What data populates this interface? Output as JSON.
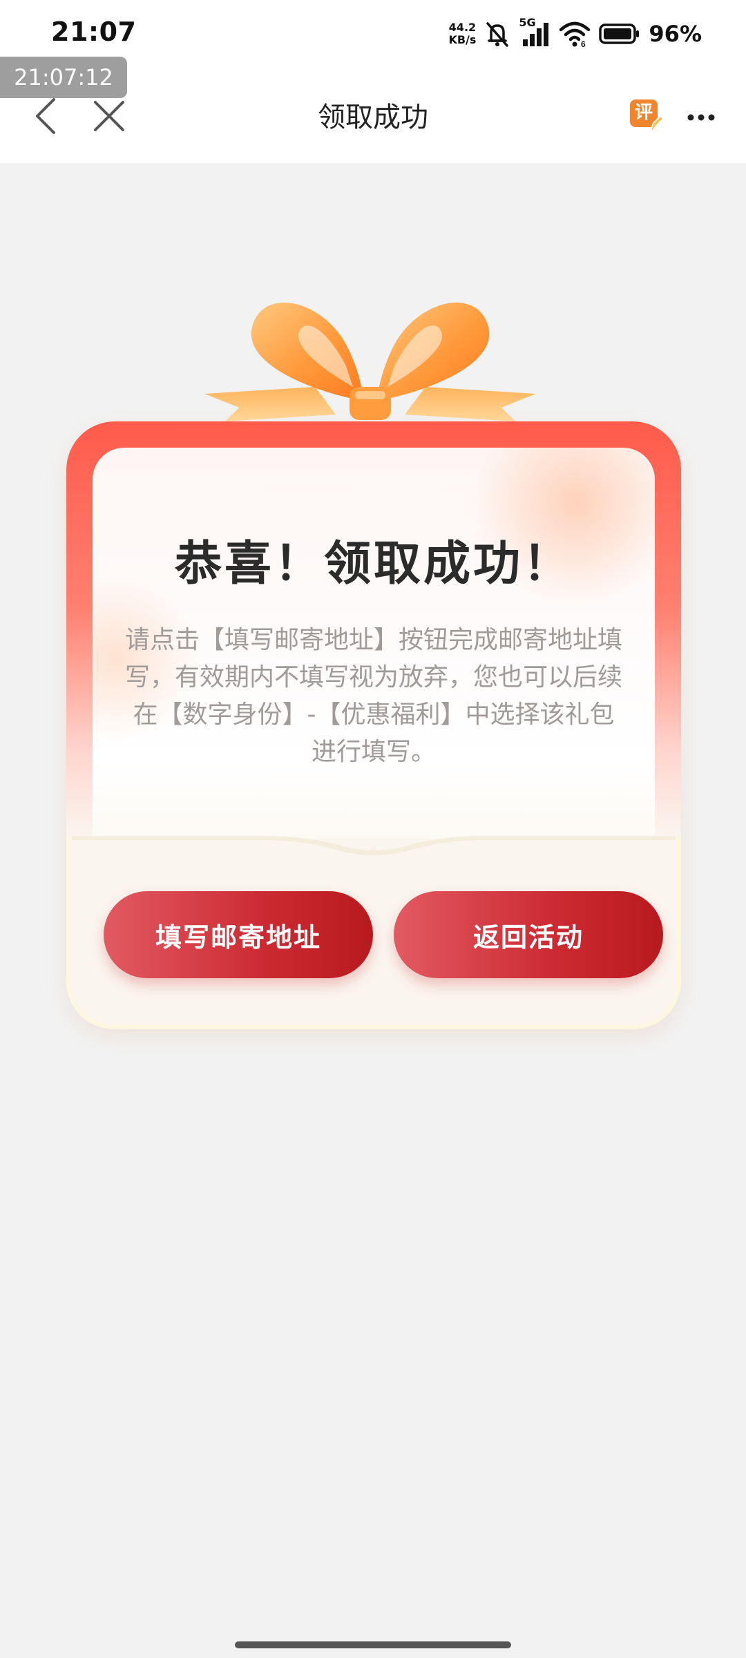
{
  "status_bar": {
    "time": "21:07",
    "net_speed_value": "44.2",
    "net_speed_unit": "KB/s",
    "network_type": "5G",
    "battery": "96%",
    "icons": [
      "mute-icon",
      "signal-icon",
      "wifi-icon",
      "battery-icon"
    ]
  },
  "time_overlay": "21:07:12",
  "nav": {
    "title": "领取成功",
    "review_badge": "评",
    "icons": [
      "back-icon",
      "close-icon",
      "review-icon",
      "more-icon"
    ]
  },
  "gift": {
    "title": "恭喜！领取成功！",
    "description": "请点击【填写邮寄地址】按钮完成邮寄地址填写，有效期内不填写视为放弃，您也可以后续在【数字身份】-【优惠福利】中选择该礼包进行填写。",
    "buttons": {
      "fill_address": "填写邮寄地址",
      "return_activity": "返回活动"
    }
  },
  "colors": {
    "accent_red": "#cc2a32",
    "ribbon_orange": "#ffa04a",
    "card_top": "#ff5b4b",
    "background": "#f2f2f2"
  }
}
